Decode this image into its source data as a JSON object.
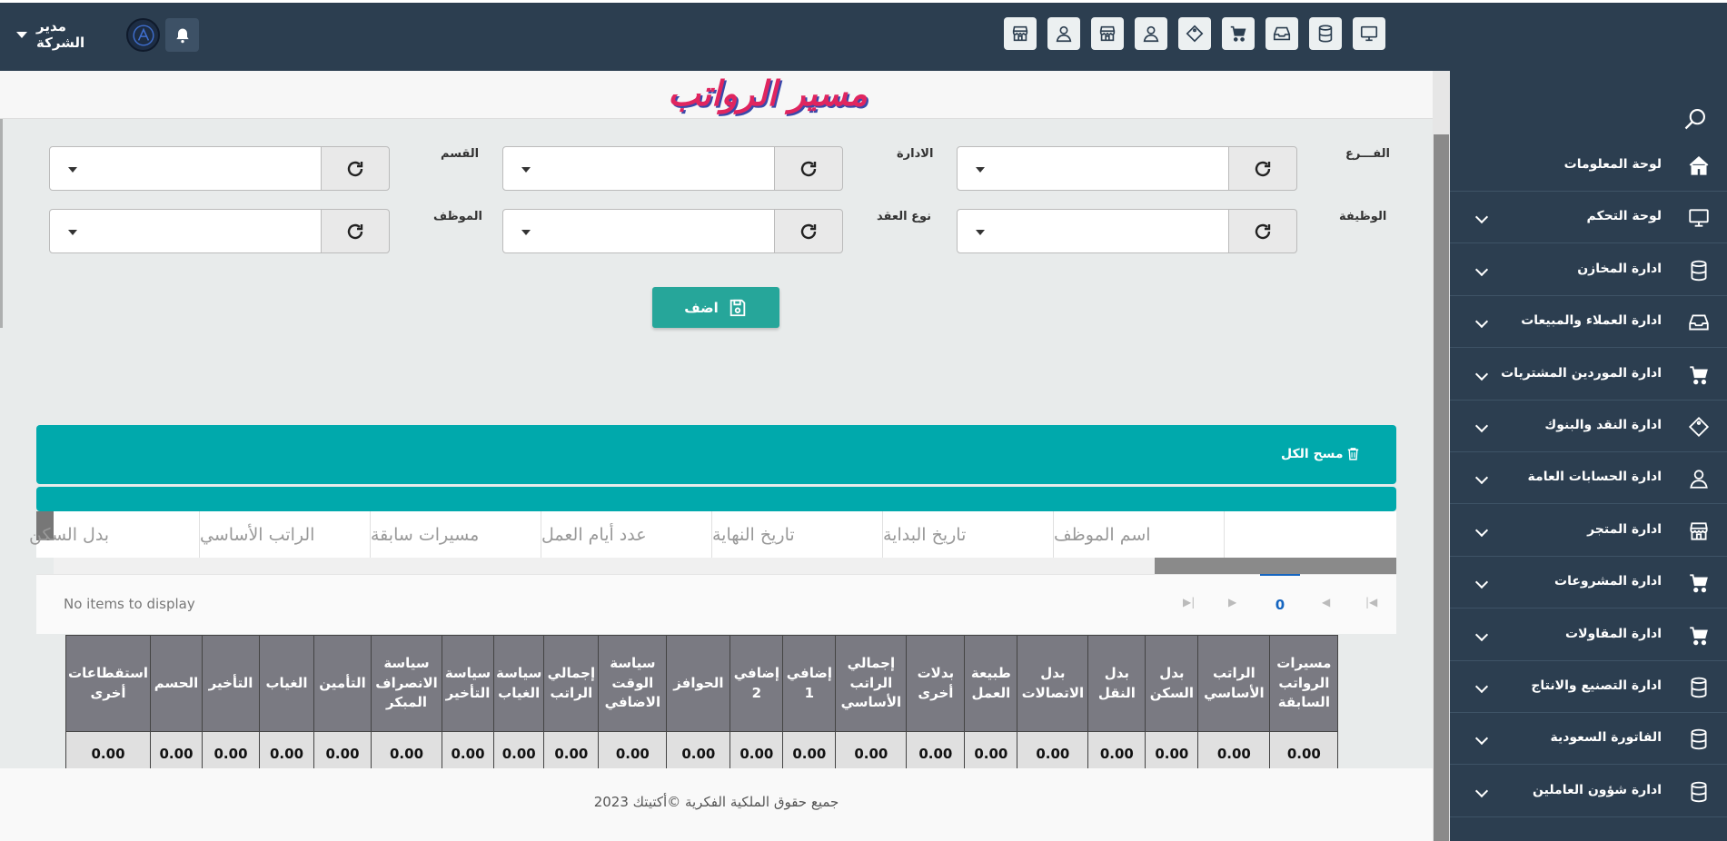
{
  "header": {
    "user_name": "مدير الشركة",
    "toolbar_icons": [
      "monitor-icon",
      "database-icon",
      "inbox-icon",
      "cart-icon",
      "tag-icon",
      "user-icon",
      "store-icon",
      "user-icon",
      "store-icon"
    ]
  },
  "sidebar": {
    "items": [
      {
        "label": "لوحة المعلومات",
        "icon": "home-icon",
        "has_children": false
      },
      {
        "label": "لوحة التحكم",
        "icon": "monitor-icon",
        "has_children": true
      },
      {
        "label": "ادارة المخازن",
        "icon": "database-icon",
        "has_children": true
      },
      {
        "label": "ادارة العملاء والمبيعات",
        "icon": "inbox-icon",
        "has_children": true
      },
      {
        "label": "ادارة الموردين المشتريات",
        "icon": "cart-icon",
        "has_children": true
      },
      {
        "label": "ادارة النقد والبنوك",
        "icon": "tag-icon",
        "has_children": true
      },
      {
        "label": "ادارة الحسابات العامة",
        "icon": "user-icon",
        "has_children": true
      },
      {
        "label": "ادارة المتجر",
        "icon": "store-icon",
        "has_children": true
      },
      {
        "label": "ادارة المشروعات",
        "icon": "cart-icon",
        "has_children": true
      },
      {
        "label": "ادارة المقاولات",
        "icon": "cart-icon",
        "has_children": true
      },
      {
        "label": "ادارة التصنيع والانتاج",
        "icon": "database-icon",
        "has_children": true
      },
      {
        "label": "الفاتورة السعودية",
        "icon": "database-icon",
        "has_children": true
      },
      {
        "label": "ادارة شؤون العاملين",
        "icon": "database-icon",
        "has_children": true
      }
    ]
  },
  "page": {
    "title": "مسير الرواتب",
    "filters": {
      "branch_label": "الفـــرع",
      "administration_label": "الادارة",
      "department_label": "القسم",
      "job_label": "الوظيفة",
      "contract_type_label": "نوع العقد",
      "employee_label": "الموظف"
    },
    "add_button": "اضف",
    "clear_all": "مسح الكل"
  },
  "grid": {
    "columns": [
      "اسم الموظف",
      "تاريخ البداية",
      "تاريخ النهاية",
      "عدد أيام العمل",
      "مسيرات سابقة",
      "الراتب الأساسي",
      "بدل السكن"
    ],
    "empty_text": "No items to display",
    "current_page": "0"
  },
  "totals": {
    "headers": [
      [
        "مسيرات",
        "الرواتب",
        "السابقة"
      ],
      [
        "الراتب",
        "الأساسي"
      ],
      [
        "بدل",
        "السكن"
      ],
      [
        "بدل",
        "النقل"
      ],
      [
        "بدل",
        "الاتصالات"
      ],
      [
        "طبيعة",
        "العمل"
      ],
      [
        "بدلات",
        "أخرى"
      ],
      [
        "إجمالي",
        "الراتب",
        "الأساسي"
      ],
      [
        "إضافي",
        "1"
      ],
      [
        "إضافي",
        "2"
      ],
      [
        "الحوافز"
      ],
      [
        "سياسة",
        "الوقت",
        "الاضافي"
      ],
      [
        "إجمالي",
        "الراتب"
      ],
      [
        "سياسة",
        "الغياب"
      ],
      [
        "سياسة",
        "التأخير"
      ],
      [
        "سياسة",
        "الانصراف",
        "المبكر"
      ],
      [
        "التأمين"
      ],
      [
        "الغياب"
      ],
      [
        "التأخير"
      ],
      [
        "الحسم"
      ],
      [
        "استقطاعات",
        "أخرى"
      ]
    ],
    "values": [
      "0.00",
      "0.00",
      "0.00",
      "0.00",
      "0.00",
      "0.00",
      "0.00",
      "0.00",
      "0.00",
      "0.00",
      "0.00",
      "0.00",
      "0.00",
      "0.00",
      "0.00",
      "0.00",
      "0.00",
      "0.00",
      "0.00",
      "0.00",
      "0.00"
    ]
  },
  "footer": {
    "text": "جميع حقوق الملكية الفكرية ©أكتيتك 2023"
  }
}
